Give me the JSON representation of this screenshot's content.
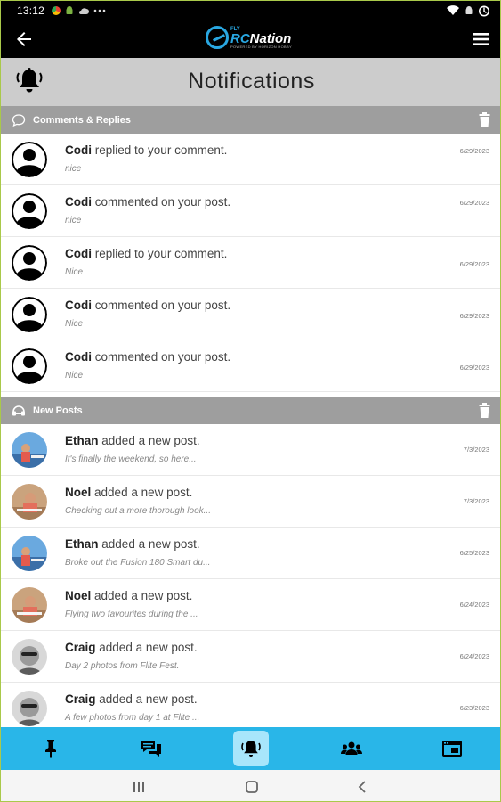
{
  "status_bar": {
    "time": "13:12",
    "indicators": [
      "chrome-icon",
      "android-icon",
      "cloud-icon",
      "more-dots-icon"
    ],
    "right": [
      "wifi-icon",
      "android-icon",
      "battery-icon"
    ]
  },
  "app_bar": {
    "logo_small": "FLY",
    "logo_rc": "RC",
    "logo_text": "Nation",
    "logo_tagline": "POWERED BY HORIZON HOBBY"
  },
  "page": {
    "title": "Notifications"
  },
  "sections": {
    "comments": {
      "title": "Comments & Replies",
      "items": [
        {
          "name": "Codi",
          "action": "replied to your comment.",
          "preview": "nice",
          "date": "6/29/2023"
        },
        {
          "name": "Codi",
          "action": "commented on your post.",
          "preview": "nice",
          "date": "6/29/2023"
        },
        {
          "name": "Codi",
          "action": "replied to your comment.",
          "preview": "Nice",
          "date": "6/29/2023"
        },
        {
          "name": "Codi",
          "action": "commented on your post.",
          "preview": "Nice",
          "date": "6/29/2023"
        },
        {
          "name": "Codi",
          "action": "commented on your post.",
          "preview": "Nice",
          "date": "6/29/2023"
        }
      ]
    },
    "new_posts": {
      "title": "New Posts",
      "items": [
        {
          "name": "Ethan",
          "action": "added a new post.",
          "preview": "It's finally the weekend, so here...",
          "date": "7/3/2023"
        },
        {
          "name": "Noel",
          "action": " added a new post.",
          "preview": "Checking out a more thorough look...",
          "date": "7/3/2023"
        },
        {
          "name": "Ethan",
          "action": "added a new post.",
          "preview": "Broke out the Fusion 180 Smart du...",
          "date": "6/25/2023"
        },
        {
          "name": "Noel",
          "action": " added a new post.",
          "preview": "Flying two favourites during the ...",
          "date": "6/24/2023"
        },
        {
          "name": "Craig",
          "action": "added a new post.",
          "preview": "Day 2 photos from Flite Fest.",
          "date": "6/24/2023"
        },
        {
          "name": "Craig",
          "action": "added a new post.",
          "preview": "A few photos from day 1 at Flite ...",
          "date": "6/23/2023"
        }
      ]
    }
  },
  "tab_bar": {
    "tabs": [
      "pin-icon",
      "chat-icon",
      "bell-icon",
      "group-icon",
      "browser-icon"
    ],
    "active_index": 2
  },
  "colors": {
    "accent": "#29b6e8",
    "section_header": "#9e9e9e",
    "page_header": "#cccccc"
  }
}
